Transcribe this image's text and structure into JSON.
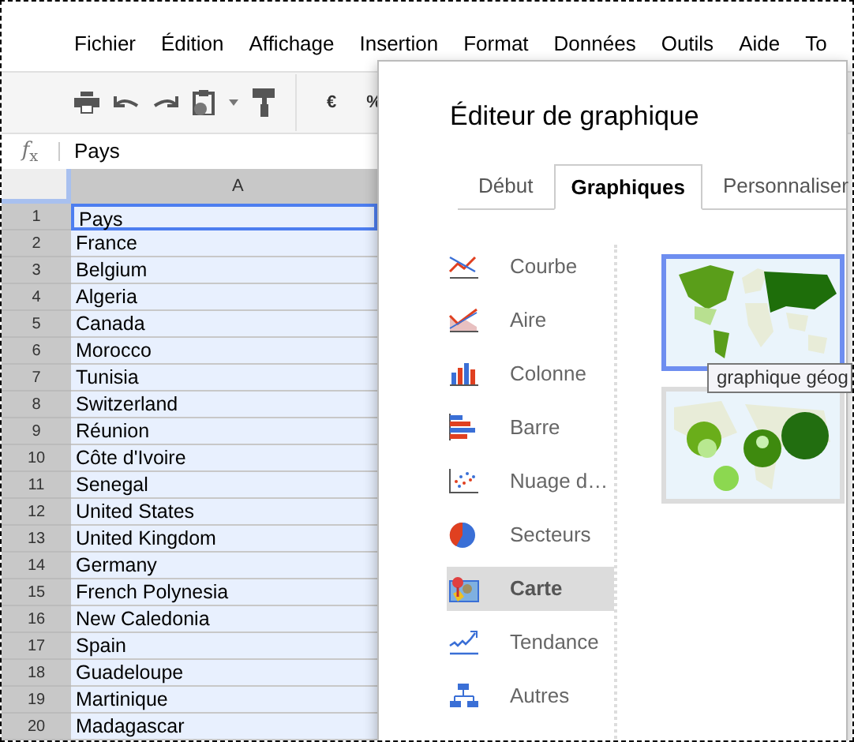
{
  "menu": [
    "Fichier",
    "Édition",
    "Affichage",
    "Insertion",
    "Format",
    "Données",
    "Outils",
    "Aide",
    "To"
  ],
  "toolbar": {
    "currency": "€",
    "percent": "%"
  },
  "formula_bar": {
    "label": "*f*$_{x}$",
    "value": "Pays"
  },
  "sheet": {
    "column": "A",
    "rows": [
      {
        "number": "1",
        "value": "Pays",
        "active": true
      },
      {
        "number": "2",
        "value": "France",
        "active": false
      },
      {
        "number": "3",
        "value": "Belgium",
        "active": false
      },
      {
        "number": "4",
        "value": "Algeria",
        "active": false
      },
      {
        "number": "5",
        "value": "Canada",
        "active": false
      },
      {
        "number": "6",
        "value": "Morocco",
        "active": false
      },
      {
        "number": "7",
        "value": "Tunisia",
        "active": false
      },
      {
        "number": "8",
        "value": "Switzerland",
        "active": false
      },
      {
        "number": "9",
        "value": "Réunion",
        "active": false
      },
      {
        "number": "10",
        "value": "Côte d'Ivoire",
        "active": false
      },
      {
        "number": "11",
        "value": "Senegal",
        "active": false
      },
      {
        "number": "12",
        "value": "United States",
        "active": false
      },
      {
        "number": "13",
        "value": "United Kingdom",
        "active": false
      },
      {
        "number": "14",
        "value": "Germany",
        "active": false
      },
      {
        "number": "15",
        "value": "French Polynesia",
        "active": false
      },
      {
        "number": "16",
        "value": "New Caledonia",
        "active": false
      },
      {
        "number": "17",
        "value": "Spain",
        "active": false
      },
      {
        "number": "18",
        "value": "Guadeloupe",
        "active": false
      },
      {
        "number": "19",
        "value": "Martinique",
        "active": false
      },
      {
        "number": "20",
        "value": "Madagascar",
        "active": false
      }
    ]
  },
  "dialog": {
    "title": "Éditeur de graphique",
    "tabs": [
      {
        "label": "Début",
        "selected": false
      },
      {
        "label": "Graphiques",
        "selected": true
      },
      {
        "label": "Personnaliser",
        "selected": false
      }
    ],
    "chart_types": [
      {
        "kind": "line",
        "label": "Courbe",
        "selected": false
      },
      {
        "kind": "area",
        "label": "Aire",
        "selected": false
      },
      {
        "kind": "column",
        "label": "Colonne",
        "selected": false
      },
      {
        "kind": "bar",
        "label": "Barre",
        "selected": false
      },
      {
        "kind": "scatter",
        "label": "Nuage d…",
        "selected": false
      },
      {
        "kind": "pie",
        "label": "Secteurs",
        "selected": false
      },
      {
        "kind": "map",
        "label": "Carte",
        "selected": true
      },
      {
        "kind": "trend",
        "label": "Tendance",
        "selected": false
      },
      {
        "kind": "other",
        "label": "Autres",
        "selected": false
      }
    ],
    "thumbnails": [
      {
        "kind": "picture",
        "selected": true
      },
      {
        "kind": "picture",
        "selected": false
      }
    ],
    "tooltip": "graphique géog"
  }
}
